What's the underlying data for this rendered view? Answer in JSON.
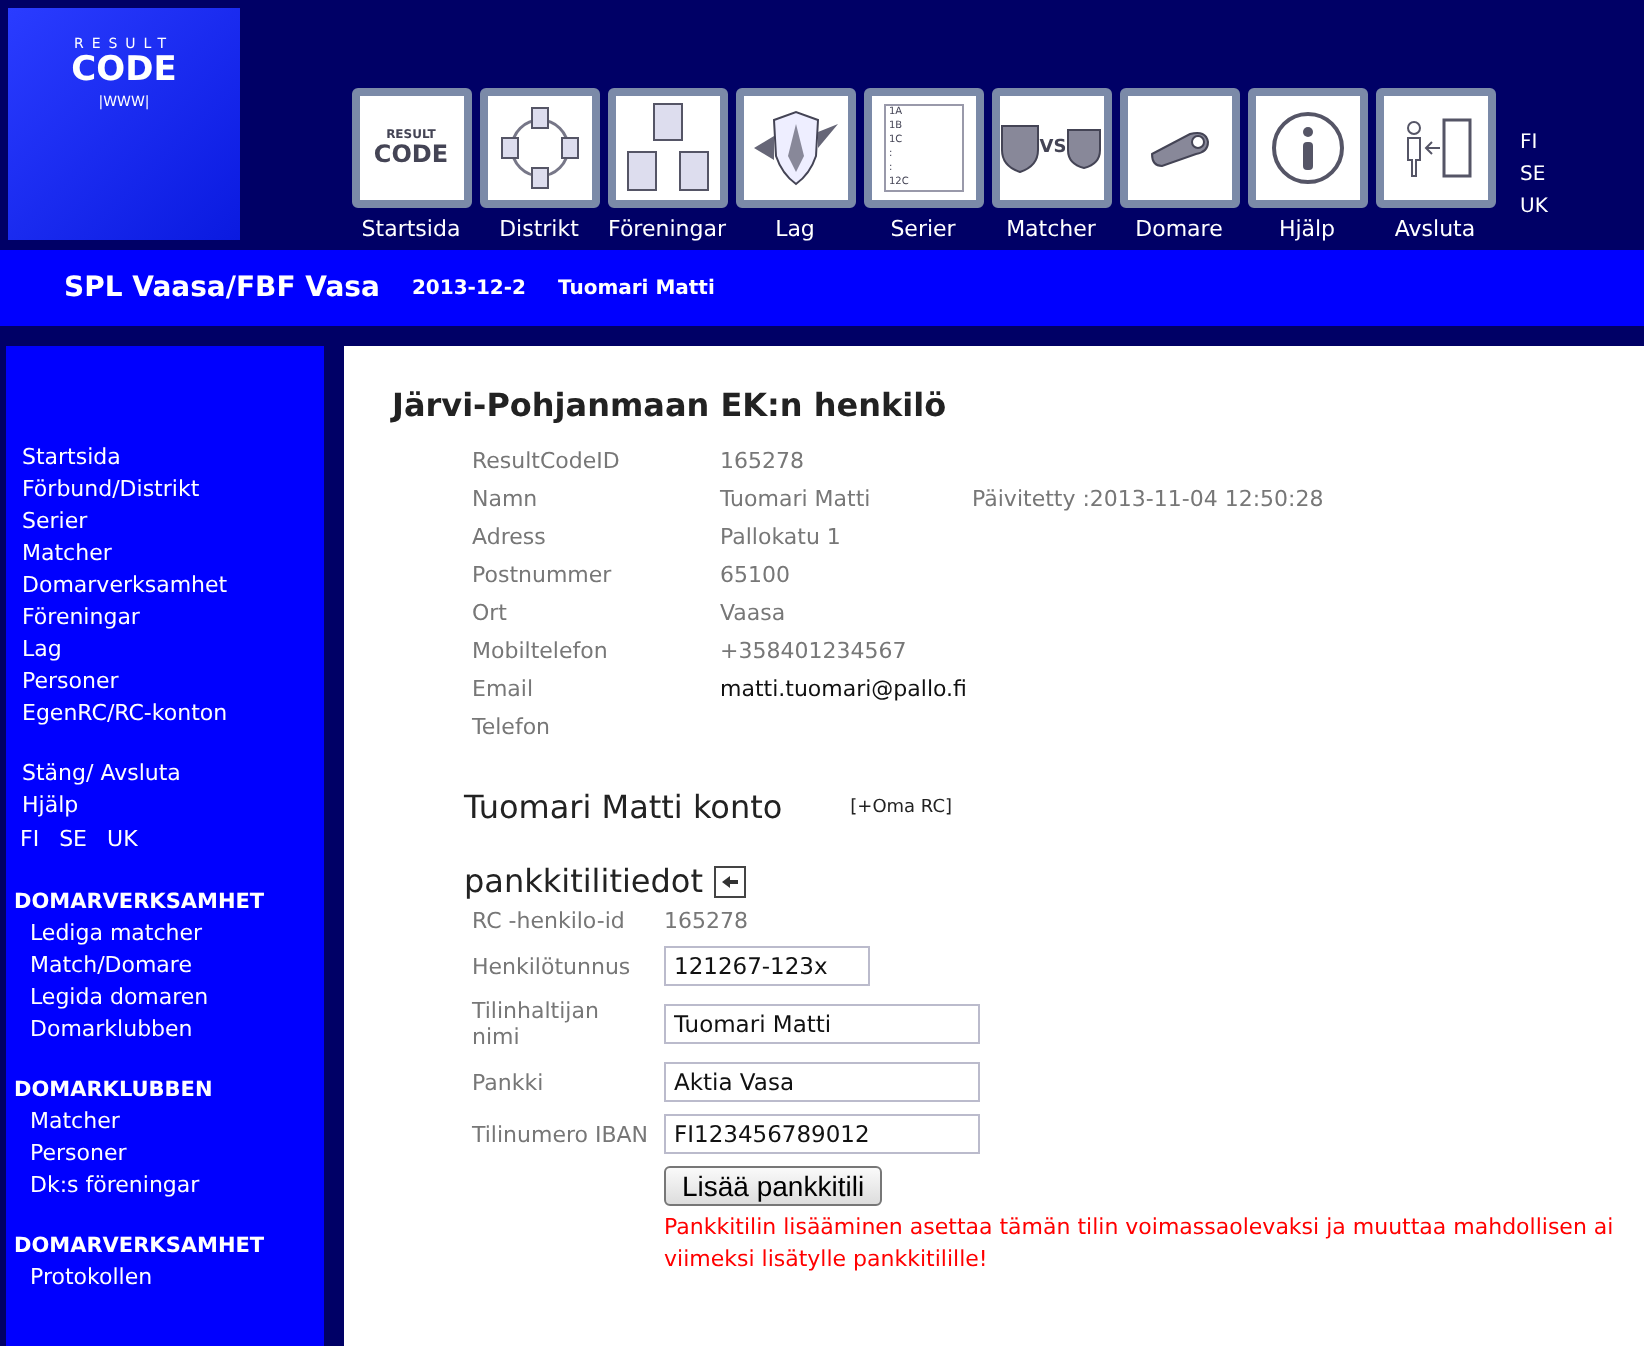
{
  "logo": {
    "top": "RESULT",
    "main": "CODE",
    "sub": "|WWW|"
  },
  "nav": [
    {
      "label": "Startsida",
      "kind": "logo"
    },
    {
      "label": "Distrikt",
      "kind": "network"
    },
    {
      "label": "Föreningar",
      "kind": "clubs"
    },
    {
      "label": "Lag",
      "kind": "shield"
    },
    {
      "label": "Serier",
      "kind": "list"
    },
    {
      "label": "Matcher",
      "kind": "versus"
    },
    {
      "label": "Domare",
      "kind": "whistle"
    },
    {
      "label": "Hjälp",
      "kind": "info"
    },
    {
      "label": "Avsluta",
      "kind": "exit"
    }
  ],
  "nav_icon_text": {
    "logo_top": "RESULT",
    "logo_main": "CODE",
    "list_lines": [
      "1A",
      "1B",
      "1C",
      ":",
      ":",
      "12C"
    ],
    "versus": "VS"
  },
  "languages": [
    "FI",
    "SE",
    "UK"
  ],
  "banner": {
    "title": "SPL Vaasa/FBF Vasa",
    "date": "2013-12-2",
    "user": "Tuomari Matti"
  },
  "sidebar": {
    "links": [
      "Startsida",
      "Förbund/Distrikt",
      "Serier",
      "Matcher",
      "Domarverksamhet",
      "Föreningar",
      "Lag",
      "Personer",
      "EgenRC/RC-konton"
    ],
    "links2": [
      "Stäng/ Avsluta",
      "Hjälp"
    ],
    "languages": [
      "FI",
      "SE",
      "UK"
    ],
    "sections": [
      {
        "title": "DOMARVERKSAMHET",
        "items": [
          "Lediga matcher",
          "Match/Domare",
          "Legida domaren",
          "Domarklubben"
        ]
      },
      {
        "title": "DOMARKLUBBEN",
        "items": [
          "Matcher",
          "Personer",
          "Dk:s föreningar"
        ]
      },
      {
        "title": "DOMARVERKSAMHET",
        "items": [
          "Protokollen"
        ]
      }
    ]
  },
  "page_title": "Järvi-Pohjanmaan EK:n henkilö",
  "person": [
    {
      "label": "ResultCodeID",
      "value": "165278"
    },
    {
      "label": "Namn",
      "value": "Tuomari Matti",
      "extra": "Päivitetty :2013-11-04 12:50:28"
    },
    {
      "label": "Adress",
      "value": "Pallokatu 1"
    },
    {
      "label": "Postnummer",
      "value": "65100"
    },
    {
      "label": "Ort",
      "value": "Vaasa"
    },
    {
      "label": "Mobiltelefon",
      "value": "+358401234567"
    },
    {
      "label": "Email",
      "value": "matti.tuomari@pallo.fi",
      "kind": "link"
    },
    {
      "label": "Telefon"
    }
  ],
  "account": {
    "title": "Tuomari Matti konto",
    "link": "[+Oma RC]"
  },
  "bank": {
    "title": "pankkitilitiedot",
    "rows": [
      {
        "label": "RC -henkilo-id",
        "value": "165278",
        "kind": "text"
      },
      {
        "label": "Henkilötunnus",
        "value": "121267-123x",
        "kind": "short"
      },
      {
        "label": "Tilinhaltijan nimi",
        "value": "Tuomari Matti",
        "kind": "input"
      },
      {
        "label": "Pankki",
        "value": "Aktia Vasa",
        "kind": "input"
      },
      {
        "label": "Tilinumero IBAN",
        "value": "FI123456789012",
        "kind": "input"
      }
    ],
    "button": "Lisää pankkitili",
    "warning": "Pankkitilin lisääminen asettaa tämän tilin voimassaolevaksi ja muuttaa mahdollisen ai viimeksi lisätylle pankkitilille!"
  }
}
